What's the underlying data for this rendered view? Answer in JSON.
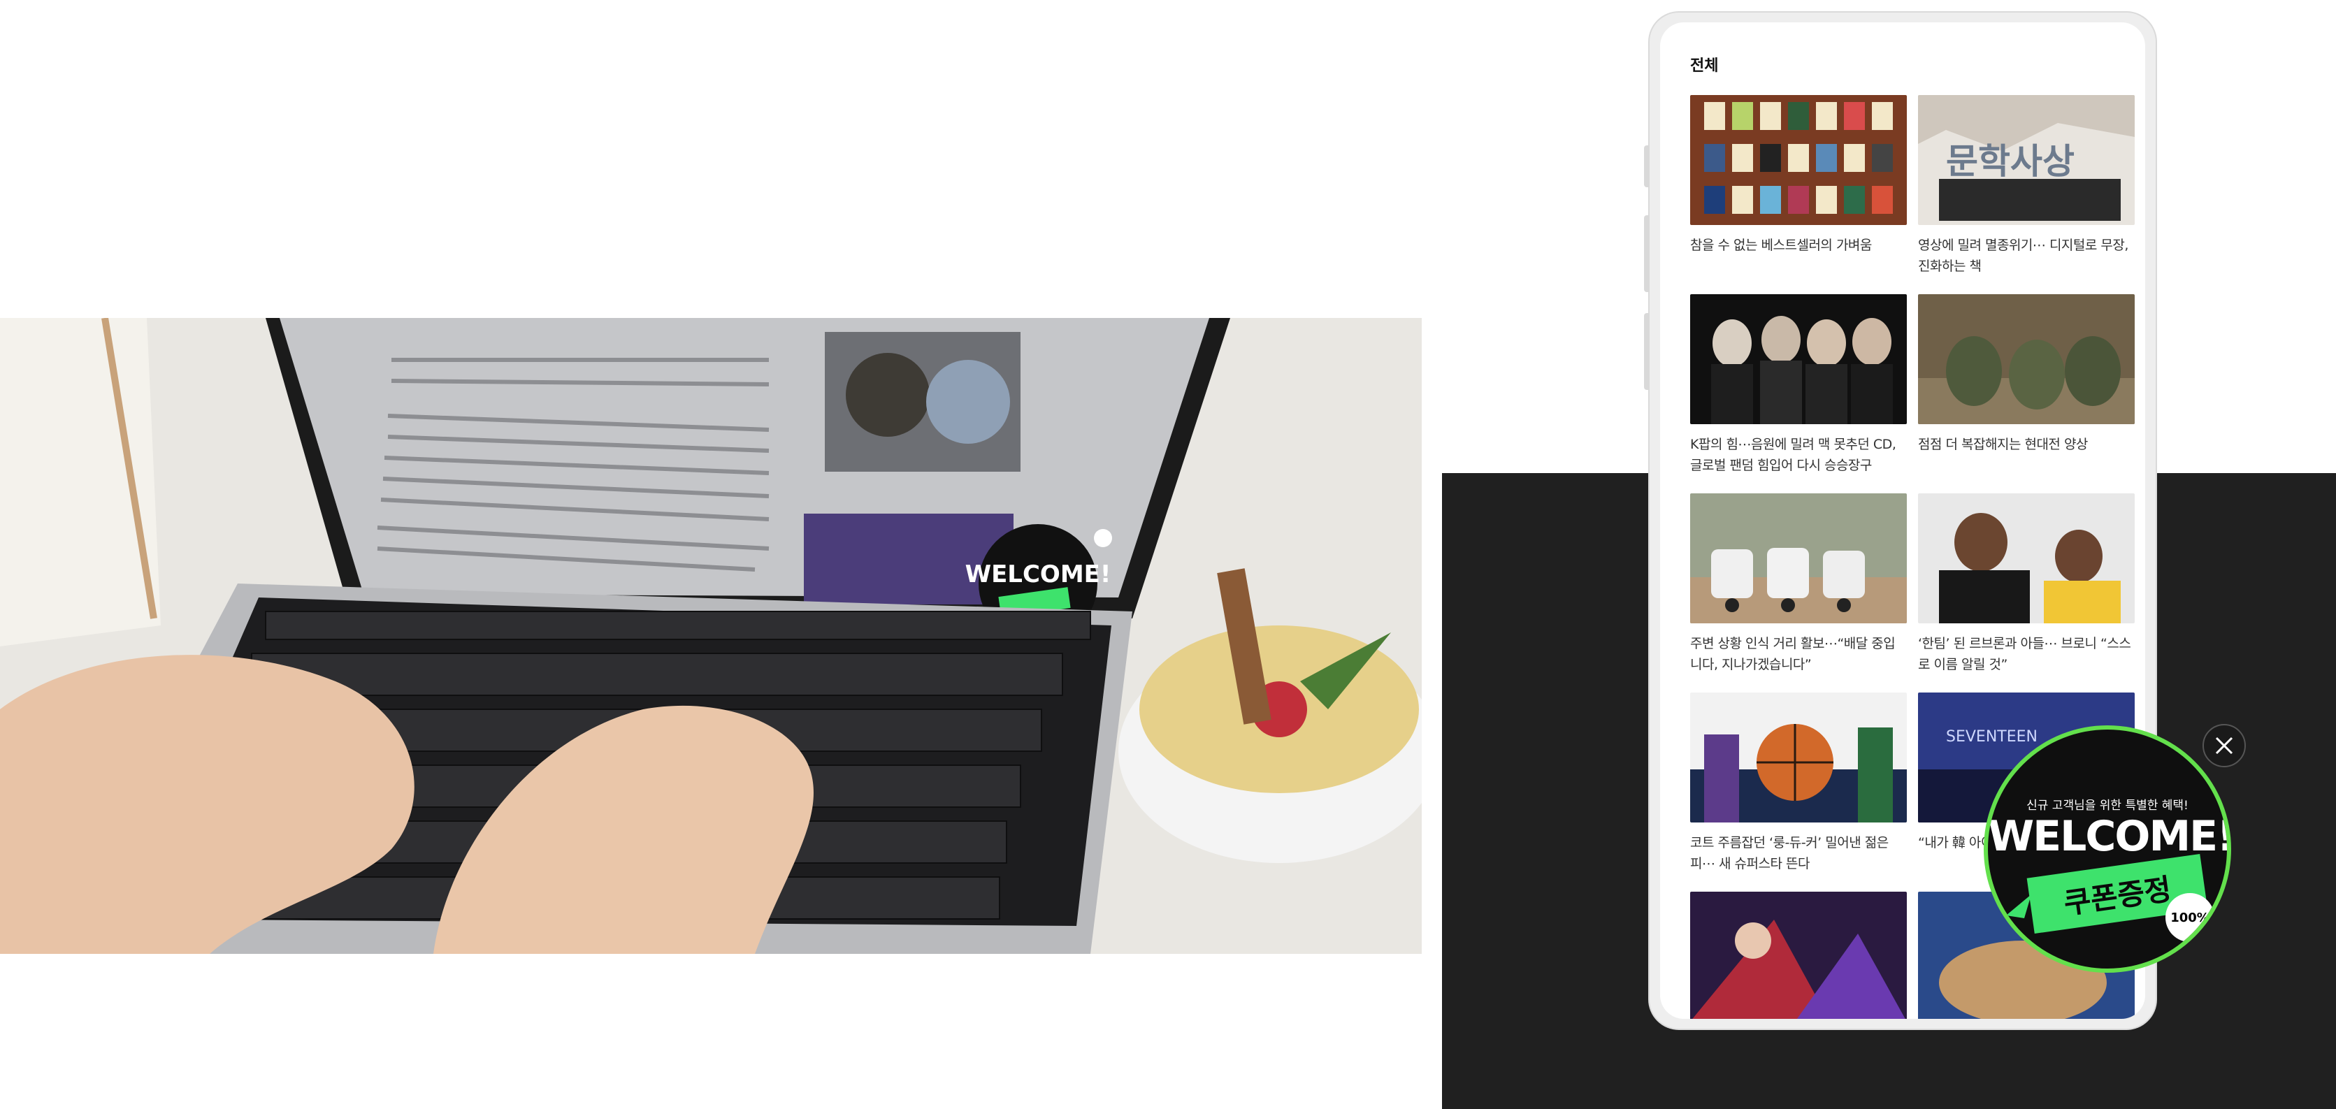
{
  "colors": {
    "dark_panel": "#202020",
    "accent_green": "#63e04c",
    "coupon_green": "#3ee26c"
  },
  "phone": {
    "title": "전체",
    "items": [
      {
        "caption": "참을 수 없는 베스트셀러의 가벼움"
      },
      {
        "caption": "영상에 밀려 멸종위기⋯ 디지털로 무장, 진화하는 책",
        "thumb_text": "문학사상"
      },
      {
        "caption": "K팝의 힘⋯음원에 밀려 맥 못추던 CD, 글로벌 팬덤 힘입어 다시 승승장구"
      },
      {
        "caption": "점점 더 복잡해지는 현대전 양상"
      },
      {
        "caption": "주변 상황 인식 거리 활보⋯“배달 중입니다, 지나가겠습니다”"
      },
      {
        "caption": "‘한팀’ 된 르브론과 아들⋯ 브로니 “스스로 이름 알릴 것”"
      },
      {
        "caption": "코트 주름잡던 ‘룽-듀-커’ 밀어낸 젊은 피⋯ 새 슈퍼스타 뜬다"
      },
      {
        "caption": "“내가 韓 아이돌… 퀴즈대회” 기브…",
        "thumb_text": "SEVENTEEN"
      },
      {
        "caption": ""
      },
      {
        "caption": ""
      }
    ]
  },
  "popup": {
    "subtitle": "신규 고객님을 위한 특별한 혜택!",
    "welcome": "WELCOME!",
    "coupon": "쿠폰증정",
    "badge": "100%"
  },
  "hero_popup": {
    "subtitle": "신규 고객님을 위한 특별한 혜택!",
    "welcome": "WELCOME!",
    "coupon": "쿠폰증정",
    "badge": "100%"
  }
}
